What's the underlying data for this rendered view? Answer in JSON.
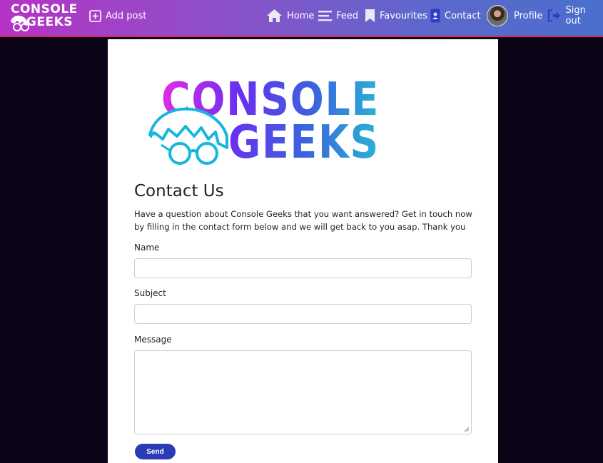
{
  "brand": {
    "line1": "CONSOLE",
    "line2": "GEEKS"
  },
  "nav": {
    "add_post": "Add post",
    "home": "Home",
    "feed": "Feed",
    "favourites": "Favourites",
    "contact": "Contact",
    "profile": "Profile",
    "sign_out": "Sign out"
  },
  "logo": {
    "line1": "CONSOLE",
    "line2": "GEEKS"
  },
  "contact": {
    "title": "Contact Us",
    "intro": "Have a question about Console Geeks that you want answered? Get in touch now by filling in the contact form below and we will get back to you asap. Thank you",
    "name_label": "Name",
    "name_value": "",
    "subject_label": "Subject",
    "subject_value": "",
    "message_label": "Message",
    "message_value": "",
    "send_label": "Send"
  },
  "colors": {
    "nav_gradient_start": "#b533c6",
    "nav_gradient_end": "#4a6fcc",
    "nav_border": "#e0245e",
    "page_background": "#0a0416",
    "send_button": "#2a3cb5",
    "logo_magenta": "#e22be4",
    "logo_violet": "#6a2ff0",
    "logo_teal": "#29b4d4"
  },
  "icons": {
    "add_post": "plus-square-icon",
    "home": "home-icon",
    "feed": "hamburger-lines-icon",
    "favourites": "bookmark-icon",
    "contact": "contact-card-icon",
    "sign_out": "sign-out-icon"
  }
}
